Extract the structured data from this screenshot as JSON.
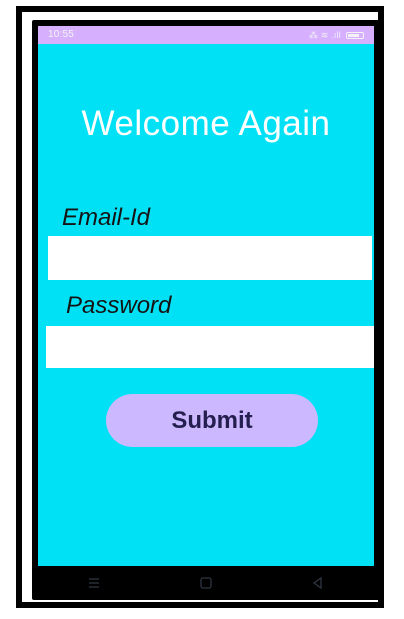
{
  "status_bar": {
    "time": "10:55",
    "indicators": "⁂ ≋ .ıll"
  },
  "main": {
    "title": "Welcome Again",
    "email_label": "Email-Id",
    "password_label": "Password",
    "submit_label": "Submit"
  },
  "navigation": {
    "menu_icon": "menu-icon",
    "home_icon": "home-icon",
    "back_icon": "back-icon"
  },
  "colors": {
    "screen_background": "#00E1F6",
    "status_bar": "#D6B0FF",
    "submit_button": "#CBB8FF",
    "button_text": "#241F4F",
    "input_background": "#FFFFFF"
  }
}
